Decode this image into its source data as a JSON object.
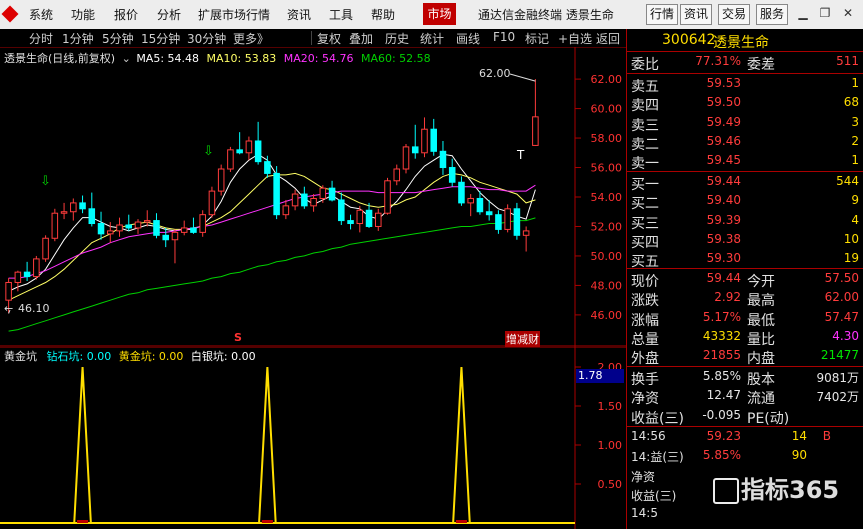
{
  "menu": {
    "items": [
      "系统",
      "功能",
      "报价",
      "分析",
      "扩展市场行情",
      "资讯",
      "工具",
      "帮助"
    ],
    "market": "市场",
    "app_title": "通达信金融终端  透景生命",
    "right_buttons": [
      "行情",
      "资讯",
      "交易",
      "服务"
    ]
  },
  "tabs": [
    "分时",
    "1分钟",
    "5分钟",
    "15分钟",
    "30分钟",
    "更多》",
    "复权",
    "叠加",
    "历史",
    "统计",
    "画线",
    "F10",
    "标记",
    "+自选",
    "返回"
  ],
  "main_chart": {
    "header_name": "透景生命(日线,前复权)",
    "ma5_label": "MA5: 54.48",
    "ma10_label": "MA10: 53.83",
    "ma20_label": "MA20: 54.76",
    "ma60_label": "MA60: 52.58",
    "high_marker": "62.00",
    "low_marker": "46.10",
    "event_label": "增减财",
    "s_marker": "S",
    "t_marker": "T"
  },
  "indicator": {
    "name": "黄金坑",
    "item1": "钻石坑: 0.00",
    "item2": "黄金坑: 0.00",
    "item3": "白银坑: 0.00",
    "cursor_value": "1.78"
  },
  "chart_data": [
    {
      "type": "candlestick",
      "title": "透景生命(日线,前复权)",
      "ylim": [
        44.5,
        63.5
      ],
      "y_ticks": [
        62.0,
        60.0,
        58.0,
        56.0,
        54.0,
        52.0,
        50.0,
        48.0,
        46.0
      ],
      "candles": [
        [
          47.0,
          48.5,
          46.1,
          48.2
        ],
        [
          48.2,
          49.0,
          47.6,
          48.9
        ],
        [
          48.9,
          49.6,
          48.3,
          48.6
        ],
        [
          48.6,
          50.0,
          48.4,
          49.8
        ],
        [
          49.8,
          51.4,
          49.6,
          51.2
        ],
        [
          51.2,
          53.2,
          51.0,
          52.9
        ],
        [
          52.9,
          53.6,
          52.5,
          53.0
        ],
        [
          53.0,
          53.9,
          52.4,
          53.6
        ],
        [
          53.6,
          54.1,
          52.9,
          53.2
        ],
        [
          53.2,
          54.3,
          52.0,
          52.2
        ],
        [
          52.2,
          53.0,
          51.1,
          51.5
        ],
        [
          51.5,
          52.3,
          50.9,
          51.7
        ],
        [
          51.7,
          52.6,
          51.3,
          52.1
        ],
        [
          52.1,
          52.8,
          51.7,
          51.9
        ],
        [
          51.9,
          52.5,
          51.5,
          52.3
        ],
        [
          52.3,
          53.1,
          52.0,
          52.4
        ],
        [
          52.4,
          52.9,
          51.2,
          51.4
        ],
        [
          51.4,
          51.9,
          50.6,
          51.1
        ],
        [
          51.1,
          51.8,
          49.5,
          51.6
        ],
        [
          51.6,
          52.4,
          51.4,
          51.9
        ],
        [
          51.9,
          52.6,
          51.5,
          51.6
        ],
        [
          51.6,
          53.1,
          51.3,
          52.8
        ],
        [
          52.8,
          54.7,
          52.6,
          54.4
        ],
        [
          54.4,
          56.2,
          54.1,
          55.9
        ],
        [
          55.9,
          57.4,
          55.7,
          57.2
        ],
        [
          57.2,
          58.4,
          56.9,
          57.0
        ],
        [
          57.0,
          58.1,
          56.5,
          57.8
        ],
        [
          57.8,
          59.1,
          56.2,
          56.4
        ],
        [
          56.4,
          56.8,
          55.3,
          55.6
        ],
        [
          55.6,
          56.1,
          52.5,
          52.8
        ],
        [
          52.8,
          53.8,
          52.5,
          53.4
        ],
        [
          53.4,
          54.5,
          53.1,
          54.2
        ],
        [
          54.2,
          54.7,
          53.2,
          53.4
        ],
        [
          53.4,
          54.2,
          53.0,
          53.9
        ],
        [
          53.9,
          54.8,
          53.6,
          54.6
        ],
        [
          54.6,
          55.1,
          53.7,
          53.8
        ],
        [
          53.8,
          54.3,
          52.1,
          52.4
        ],
        [
          52.4,
          52.8,
          51.8,
          52.2
        ],
        [
          52.2,
          53.4,
          51.6,
          53.1
        ],
        [
          53.1,
          53.6,
          51.9,
          52.0
        ],
        [
          52.0,
          53.2,
          51.7,
          52.9
        ],
        [
          52.9,
          55.3,
          52.8,
          55.1
        ],
        [
          55.1,
          56.2,
          54.8,
          55.9
        ],
        [
          55.9,
          57.6,
          55.6,
          57.4
        ],
        [
          57.4,
          58.9,
          56.6,
          57.0
        ],
        [
          57.0,
          59.4,
          56.7,
          58.6
        ],
        [
          58.6,
          59.3,
          56.8,
          57.1
        ],
        [
          57.1,
          57.8,
          55.5,
          56.0
        ],
        [
          56.0,
          56.6,
          54.7,
          55.0
        ],
        [
          55.0,
          55.4,
          53.4,
          53.6
        ],
        [
          53.6,
          54.2,
          52.7,
          53.9
        ],
        [
          53.9,
          54.4,
          52.8,
          53.0
        ],
        [
          53.0,
          53.8,
          52.4,
          52.8
        ],
        [
          52.8,
          53.1,
          51.5,
          51.8
        ],
        [
          51.8,
          53.5,
          51.6,
          53.2
        ],
        [
          53.2,
          53.6,
          51.1,
          51.4
        ],
        [
          51.4,
          52.0,
          50.3,
          51.7
        ],
        [
          57.5,
          62.0,
          57.47,
          59.44
        ]
      ],
      "ma": [
        {
          "name": "MA5",
          "color": "#ffffff",
          "values": [
            47.6,
            47.9,
            48.1,
            48.5,
            49.1,
            50.1,
            51.1,
            51.9,
            52.6,
            52.6,
            52.3,
            52.0,
            51.9,
            51.7,
            51.9,
            52.1,
            52.0,
            51.8,
            51.7,
            51.8,
            51.8,
            52.1,
            52.7,
            53.7,
            55.0,
            55.9,
            56.5,
            56.9,
            56.5,
            55.5,
            55.1,
            54.6,
            53.9,
            53.5,
            53.8,
            54.1,
            53.7,
            53.3,
            53.2,
            52.7,
            52.5,
            53.1,
            53.7,
            54.5,
            55.4,
            56.1,
            56.5,
            56.9,
            56.8,
            55.9,
            55.1,
            54.3,
            53.7,
            53.2,
            53.0,
            52.7,
            52.5,
            54.5
          ]
        },
        {
          "name": "MA10",
          "color": "#ffff66",
          "values": [
            47.0,
            47.3,
            47.6,
            47.9,
            48.2,
            48.6,
            49.1,
            49.7,
            50.3,
            50.9,
            51.2,
            51.5,
            51.9,
            52.1,
            52.2,
            52.3,
            52.1,
            51.9,
            51.8,
            51.8,
            51.9,
            52.0,
            52.3,
            52.6,
            53.0,
            53.6,
            54.2,
            54.8,
            55.4,
            55.5,
            55.5,
            55.6,
            55.4,
            55.0,
            54.6,
            54.5,
            54.2,
            53.9,
            53.6,
            53.4,
            53.3,
            53.4,
            53.5,
            53.8,
            54.0,
            54.5,
            55.0,
            55.4,
            55.6,
            55.5,
            55.3,
            55.0,
            54.8,
            54.6,
            54.4,
            54.2,
            53.6,
            53.8
          ]
        },
        {
          "name": "MA20",
          "color": "#ff33ff",
          "values": [
            48.5,
            48.5,
            48.6,
            48.8,
            49.0,
            49.3,
            49.6,
            49.9,
            50.2,
            50.4,
            50.6,
            50.9,
            51.1,
            51.3,
            51.4,
            51.5,
            51.6,
            51.6,
            51.7,
            51.8,
            51.9,
            52.0,
            52.1,
            52.3,
            52.5,
            52.7,
            52.9,
            53.1,
            53.3,
            53.5,
            53.7,
            53.9,
            54.0,
            54.1,
            54.2,
            54.3,
            54.4,
            54.4,
            54.4,
            54.4,
            54.3,
            54.3,
            54.3,
            54.3,
            54.3,
            54.4,
            54.5,
            54.6,
            54.7,
            54.7,
            54.7,
            54.6,
            54.5,
            54.5,
            54.4,
            54.4,
            54.4,
            54.8
          ]
        },
        {
          "name": "MA60",
          "color": "#00d000",
          "values": [
            44.9,
            45.0,
            45.2,
            45.4,
            45.6,
            45.8,
            46.0,
            46.2,
            46.4,
            46.6,
            46.8,
            47.0,
            47.2,
            47.4,
            47.5,
            47.7,
            47.8,
            47.9,
            48.0,
            48.1,
            48.2,
            48.3,
            48.5,
            48.6,
            48.8,
            48.9,
            49.1,
            49.3,
            49.4,
            49.6,
            49.7,
            49.9,
            50.0,
            50.2,
            50.3,
            50.5,
            50.6,
            50.8,
            50.9,
            51.0,
            51.1,
            51.2,
            51.3,
            51.4,
            51.5,
            51.6,
            51.7,
            51.8,
            51.9,
            52.0,
            52.0,
            52.1,
            52.2,
            52.2,
            52.3,
            52.4,
            52.4,
            52.58
          ]
        }
      ]
    },
    {
      "type": "line",
      "title": "黄金坑",
      "ylim": [
        0,
        2.0
      ],
      "y_ticks": [
        2.0,
        1.5,
        1.0,
        0.5
      ],
      "spikes_at_index": [
        8,
        28,
        49
      ],
      "spike_value": 2.0
    }
  ],
  "quote": {
    "code": "300642",
    "name": "透景生命",
    "weibi_label": "委比",
    "weibi": "77.31%",
    "weicha_label": "委差",
    "weicha": "511",
    "asks": [
      {
        "label": "卖五",
        "price": "59.53",
        "vol": "1"
      },
      {
        "label": "卖四",
        "price": "59.50",
        "vol": "68"
      },
      {
        "label": "卖三",
        "price": "59.49",
        "vol": "3"
      },
      {
        "label": "卖二",
        "price": "59.46",
        "vol": "2"
      },
      {
        "label": "卖一",
        "price": "59.45",
        "vol": "1"
      }
    ],
    "bids": [
      {
        "label": "买一",
        "price": "59.44",
        "vol": "544"
      },
      {
        "label": "买二",
        "price": "59.40",
        "vol": "9"
      },
      {
        "label": "买三",
        "price": "59.39",
        "vol": "4"
      },
      {
        "label": "买四",
        "price": "59.38",
        "vol": "10"
      },
      {
        "label": "买五",
        "price": "59.30",
        "vol": "19"
      }
    ],
    "stats": [
      {
        "l1": "现价",
        "v1": "59.44",
        "c1": "red",
        "l2": "今开",
        "v2": "57.50",
        "c2": "red"
      },
      {
        "l1": "涨跌",
        "v1": "2.92",
        "c1": "red",
        "l2": "最高",
        "v2": "62.00",
        "c2": "red"
      },
      {
        "l1": "涨幅",
        "v1": "5.17%",
        "c1": "red",
        "l2": "最低",
        "v2": "57.47",
        "c2": "red"
      },
      {
        "l1": "总量",
        "v1": "43332",
        "c1": "yellow",
        "l2": "量比",
        "v2": "4.30",
        "c2": "magenta"
      },
      {
        "l1": "外盘",
        "v1": "21855",
        "c1": "red",
        "l2": "内盘",
        "v2": "21477",
        "c2": "green"
      }
    ],
    "stats2": [
      {
        "l1": "换手",
        "v1": "5.85%",
        "l2": "股本",
        "v2": "9081万"
      },
      {
        "l1": "净资",
        "v1": "12.47",
        "l2": "流通",
        "v2": "7402万"
      },
      {
        "l1": "收益(三)",
        "v1": "-0.095",
        "l2": "PE(动)",
        "v2": ""
      }
    ],
    "ticks": [
      {
        "time": "14:56",
        "price": "59.23",
        "vol": "14",
        "dir": "B"
      },
      {
        "time": "14:益(三)",
        "price": "5.85%",
        "vol": "90",
        "dir": ""
      },
      {
        "time": "净资",
        "price": "",
        "vol": "",
        "dir": ""
      },
      {
        "time": "收益(三)",
        "price": "",
        "vol": "",
        "dir": ""
      },
      {
        "time": "14:5",
        "price": "",
        "vol": "",
        "dir": ""
      }
    ]
  },
  "watermark": "指标365"
}
